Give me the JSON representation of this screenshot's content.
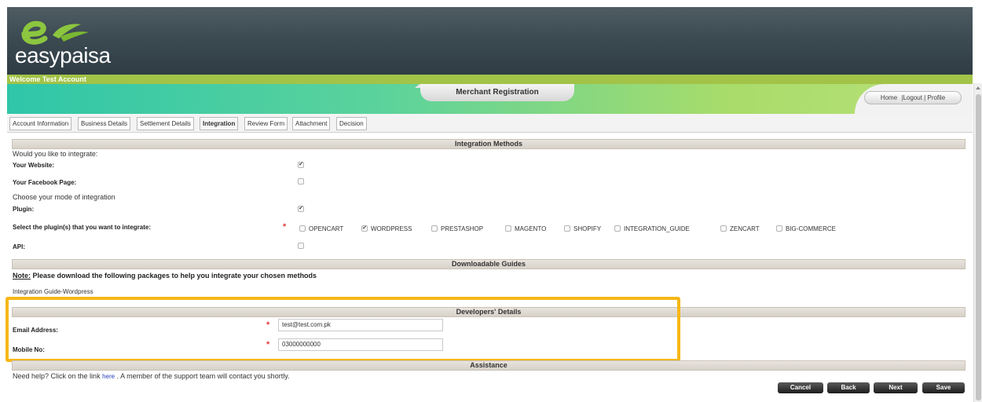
{
  "brand": {
    "name": "easypaisa"
  },
  "welcome_text": "Welcome Test Account",
  "banner": {
    "title": "Merchant Registration"
  },
  "top_links": {
    "home": "Home",
    "logout": "Logout",
    "profile": "Profile",
    "separator": "|"
  },
  "tabs": [
    "Account Information",
    "Business Details",
    "Settlement Details",
    "Integration",
    "Review Form",
    "Attachment",
    "Decision"
  ],
  "active_tab": "Integration",
  "integration_methods": {
    "section_title": "Integration Methods",
    "question": "Would you like to integrate:",
    "website_label": "Your Website:",
    "website_checked": true,
    "facebook_label": "Your Facebook Page:",
    "facebook_checked": false,
    "mode_question": "Choose your mode of integration",
    "plugin_label": "Plugin:",
    "plugin_checked": true,
    "select_plugins_label": "Select the plugin(s) that you want to integrate:",
    "plugins": [
      {
        "name": "OPENCART",
        "checked": false
      },
      {
        "name": "WORDPRESS",
        "checked": true
      },
      {
        "name": "PRESTASHOP",
        "checked": false
      },
      {
        "name": "MAGENTO",
        "checked": false
      },
      {
        "name": "SHOPIFY",
        "checked": false
      },
      {
        "name": "INTEGRATION_GUIDE",
        "checked": false
      },
      {
        "name": "ZENCART",
        "checked": false
      },
      {
        "name": "BIG-COMMERCE",
        "checked": false
      }
    ],
    "api_label": "API:",
    "api_checked": false
  },
  "guides": {
    "section_title": "Downloadable Guides",
    "note_label": "Note:",
    "note_text": " Please download the following packages to help you integrate your chosen methods",
    "guide_link": "Integration Guide-Wordpress"
  },
  "developers": {
    "section_title": "Developers' Details",
    "email_label": "Email Address:",
    "email_value": "test@test.com.pk",
    "mobile_label": "Mobile No:",
    "mobile_value": "03000000000"
  },
  "assistance": {
    "section_title": "Assistance",
    "text_before": "Need help? Click on the link ",
    "link_text": "here",
    "text_after": " . A member of the support team will contact you shortly."
  },
  "buttons": {
    "cancel": "Cancel",
    "back": "Back",
    "next": "Next",
    "save": "Save"
  },
  "colors": {
    "header_dark": "#3c4a52",
    "welcome_green": "#a2c347",
    "highlight": "#f6b717",
    "required": "#e33b3b"
  }
}
